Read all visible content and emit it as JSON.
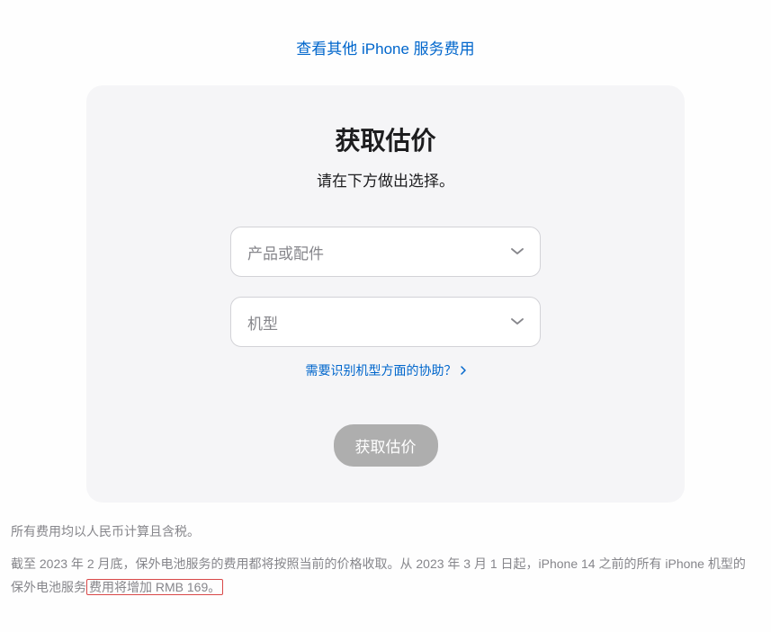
{
  "top_link": "查看其他 iPhone 服务费用",
  "card": {
    "title": "获取估价",
    "subtitle": "请在下方做出选择。",
    "select_product_placeholder": "产品或配件",
    "select_model_placeholder": "机型",
    "help_link": "需要识别机型方面的协助？",
    "button": "获取估价"
  },
  "footer": {
    "line1": "所有费用均以人民币计算且含税。",
    "line2_prefix": "截至 2023 年 2 月底，保外电池服务的费用都将按照当前的价格收取。从 2023 年 3 月 1 日起，iPhone 14 之前的所有 iPhone 机型的保外电池服务",
    "line2_highlight": "费用将增加 RMB 169。"
  }
}
